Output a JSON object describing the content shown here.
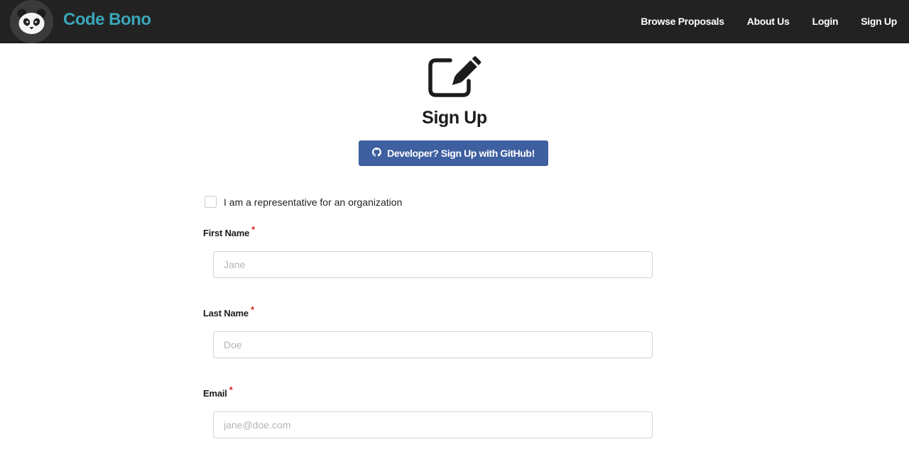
{
  "brand": {
    "name": "Code Bono"
  },
  "nav": {
    "items": [
      {
        "label": "Browse Proposals"
      },
      {
        "label": "About Us"
      },
      {
        "label": "Login"
      },
      {
        "label": "Sign Up"
      }
    ]
  },
  "page": {
    "title": "Sign Up",
    "header_icon": "edit-icon",
    "github_button_label": "Developer? Sign Up with GitHub!",
    "github_icon": "github-icon"
  },
  "form": {
    "org_checkbox": {
      "label": "I am a representative for an organization",
      "checked": false
    },
    "fields": [
      {
        "label": "First Name",
        "required_mark": "*",
        "placeholder": "Jane",
        "value": ""
      },
      {
        "label": "Last Name",
        "required_mark": "*",
        "placeholder": "Doe",
        "value": ""
      },
      {
        "label": "Email",
        "required_mark": "*",
        "placeholder": "jane@doe.com",
        "value": ""
      }
    ]
  },
  "colors": {
    "navbar_bg": "#222222",
    "brand": "#3aa6b9",
    "github_button": "#3e5fa0",
    "required": "#db2828"
  }
}
